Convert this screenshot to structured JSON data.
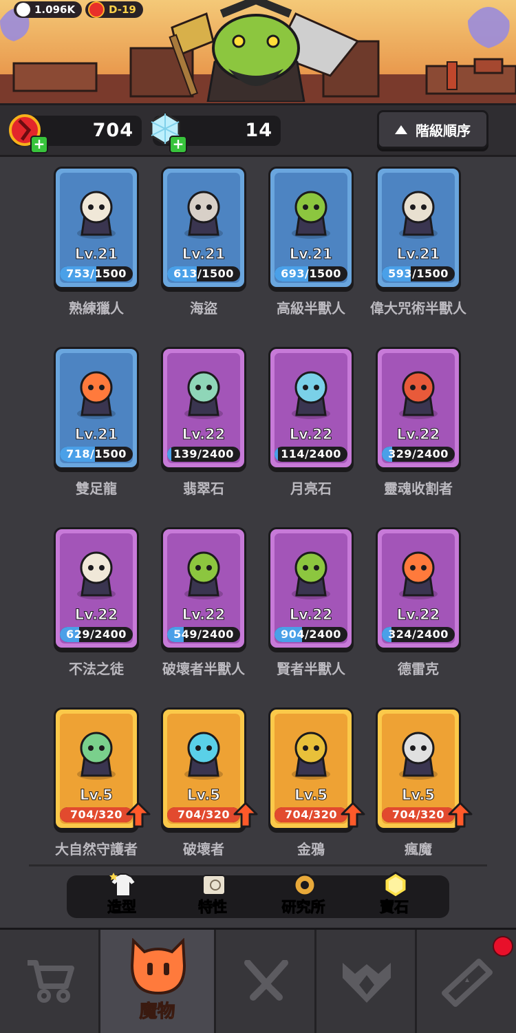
{
  "top": {
    "likes": "1.096K",
    "stage": "D-19"
  },
  "resources": {
    "red_gems": "704",
    "diamonds": "14",
    "sort_label": "階級順序"
  },
  "monsters": [
    {
      "level": "Lv.21",
      "progress": "753/1500",
      "fraction": 0.502,
      "name": "熟練獵人",
      "rarity": "blue"
    },
    {
      "level": "Lv.21",
      "progress": "613/1500",
      "fraction": 0.409,
      "name": "海盜",
      "rarity": "blue"
    },
    {
      "level": "Lv.21",
      "progress": "693/1500",
      "fraction": 0.462,
      "name": "高級半獸人",
      "rarity": "blue"
    },
    {
      "level": "Lv.21",
      "progress": "593/1500",
      "fraction": 0.395,
      "name": "偉大咒術半獸人",
      "rarity": "blue"
    },
    {
      "level": "Lv.21",
      "progress": "718/1500",
      "fraction": 0.479,
      "name": "雙足龍",
      "rarity": "blue"
    },
    {
      "level": "Lv.22",
      "progress": "139/2400",
      "fraction": 0.058,
      "name": "翡翠石",
      "rarity": "purple"
    },
    {
      "level": "Lv.22",
      "progress": "114/2400",
      "fraction": 0.048,
      "name": "月亮石",
      "rarity": "purple"
    },
    {
      "level": "Lv.22",
      "progress": "329/2400",
      "fraction": 0.137,
      "name": "靈魂收割者",
      "rarity": "purple"
    },
    {
      "level": "Lv.22",
      "progress": "629/2400",
      "fraction": 0.262,
      "name": "不法之徒",
      "rarity": "purple"
    },
    {
      "level": "Lv.22",
      "progress": "549/2400",
      "fraction": 0.229,
      "name": "破壞者半獸人",
      "rarity": "purple"
    },
    {
      "level": "Lv.22",
      "progress": "904/2400",
      "fraction": 0.377,
      "name": "賢者半獸人",
      "rarity": "purple"
    },
    {
      "level": "Lv.22",
      "progress": "324/2400",
      "fraction": 0.135,
      "name": "德雷克",
      "rarity": "purple"
    },
    {
      "level": "Lv.5",
      "progress": "704/320",
      "fraction": 1.0,
      "name": "大自然守護者",
      "rarity": "gold",
      "upgrade": true
    },
    {
      "level": "Lv.5",
      "progress": "704/320",
      "fraction": 1.0,
      "name": "破壞者",
      "rarity": "gold",
      "upgrade": true
    },
    {
      "level": "Lv.5",
      "progress": "704/320",
      "fraction": 1.0,
      "name": "金鴉",
      "rarity": "gold",
      "upgrade": true
    },
    {
      "level": "Lv.5",
      "progress": "704/320",
      "fraction": 1.0,
      "name": "瘋魔",
      "rarity": "gold",
      "upgrade": true
    }
  ],
  "toolbar": {
    "skin": "造型",
    "traits": "特性",
    "research": "研究所",
    "gems": "寶石"
  },
  "nav": {
    "monsters": "魔物"
  },
  "colors": {
    "accent_orange": "#ff7a3c",
    "blue_card": "#6aa6de",
    "purple_card": "#c77ad8",
    "gold_card": "#fbc94a"
  }
}
